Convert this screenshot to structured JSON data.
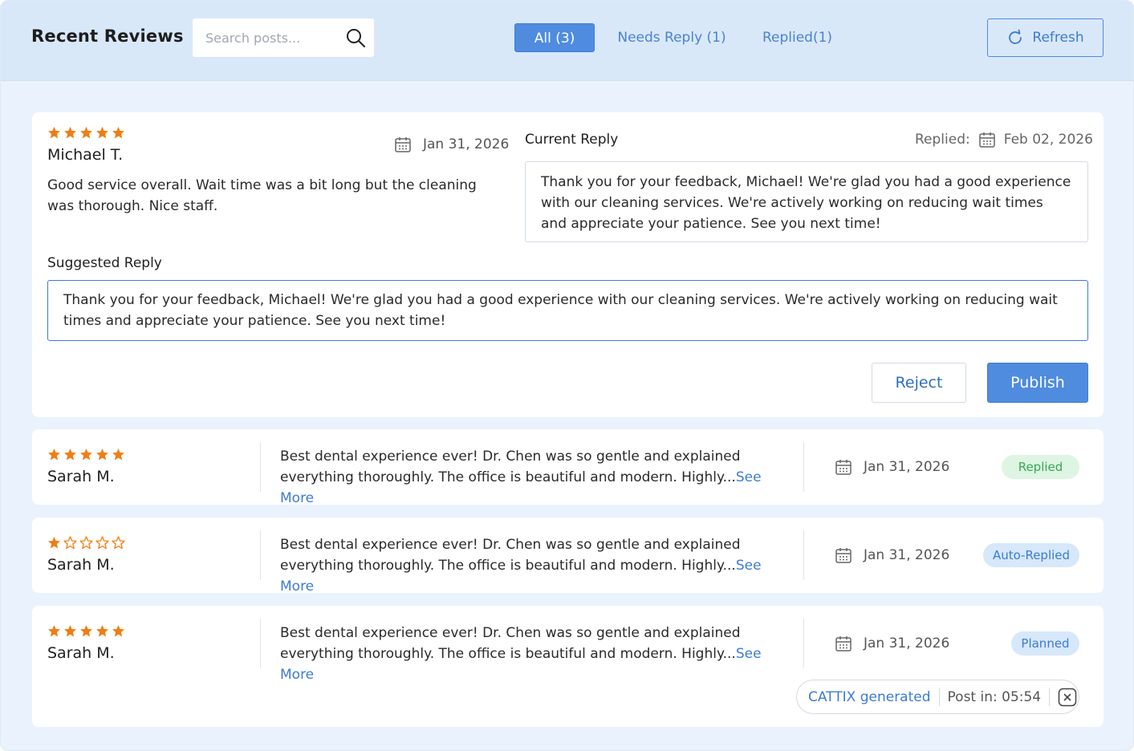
{
  "header": {
    "title": "Recent Reviews",
    "search_placeholder": "Search posts...",
    "tabs": [
      {
        "label": "All (3)",
        "active": true
      },
      {
        "label": "Needs Reply (1)",
        "active": false
      },
      {
        "label": "Replied(1)",
        "active": false
      }
    ],
    "refresh_label": "Refresh"
  },
  "expanded_review": {
    "rating": 5,
    "reviewer": "Michael T.",
    "date": "Jan 31, 2026",
    "text": "Good service overall. Wait time was a bit long but the cleaning was thorough. Nice staff.",
    "current_reply_label": "Current Reply",
    "replied_label": "Replied:",
    "replied_date": "Feb 02, 2026",
    "current_reply_text": "Thank you for your feedback, Michael! We're glad you had a good experience with our cleaning services. We're actively working on reducing wait times and appreciate your patience. See you next time!",
    "suggested_reply_label": "Suggested Reply",
    "suggested_reply_text": "Thank you for your feedback, Michael! We're glad you had a good experience with our cleaning services. We're actively working on reducing wait times and appreciate your patience. See you next time!",
    "reject_label": "Reject",
    "publish_label": "Publish"
  },
  "reviews": [
    {
      "rating": 5,
      "reviewer": "Sarah M.",
      "text": "Best dental experience ever! Dr. Chen was so gentle and explained everything thoroughly. The office is beautiful and modern. Highly...",
      "see_more": "See More",
      "date": "Jan 31, 2026",
      "status": "Replied",
      "status_color": "#3aa65a",
      "status_bg": "#def5e3"
    },
    {
      "rating": 1,
      "reviewer": "Sarah M.",
      "text": "Best dental experience ever! Dr. Chen was so gentle and explained everything thoroughly. The office is beautiful and modern. Highly...",
      "see_more": "See More",
      "date": "Jan 31, 2026",
      "status": "Auto-Replied",
      "status_color": "#3d7bd4",
      "status_bg": "#d6e8fa"
    },
    {
      "rating": 5,
      "reviewer": "Sarah M.",
      "text": "Best dental experience ever! Dr. Chen was so gentle and explained everything thoroughly. The office is beautiful and modern. Highly...",
      "see_more": "See More",
      "date": "Jan 31, 2026",
      "status": "Planned",
      "status_color": "#3d7bd4",
      "status_bg": "#d6e8fa"
    }
  ],
  "footer": {
    "generated_label": "CATTIX generated",
    "post_in_label": "Post in: 05:54"
  },
  "colors": {
    "accent": "#4f8ce0",
    "star": "#f07d14",
    "background": "#eaf3fd"
  },
  "icons": [
    "search-icon",
    "refresh-icon",
    "calendar-icon",
    "star-icon",
    "close-icon"
  ]
}
